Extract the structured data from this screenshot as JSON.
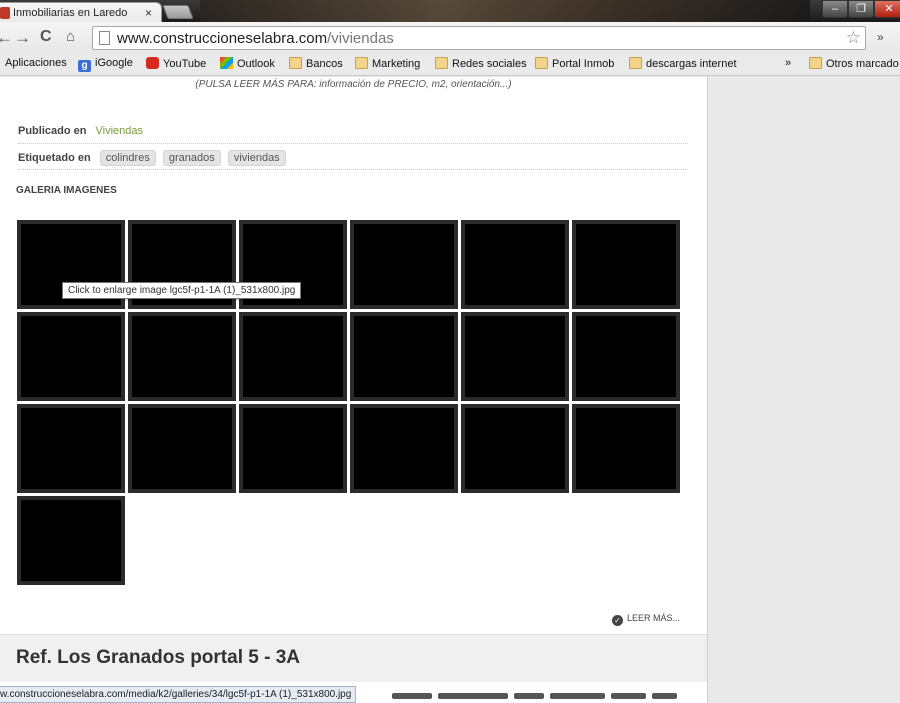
{
  "window": {
    "tab_title": "Inmobiliarias en Laredo",
    "tab_close": "×",
    "controls": {
      "minimize": "–",
      "maximize": "❐",
      "close": "✕"
    }
  },
  "toolbar": {
    "back": "←",
    "forward": "→",
    "reload": "C",
    "home": "⌂",
    "url_host": "www.construccioneselabra.com",
    "url_path": "/viviendas",
    "star": "☆",
    "overflow": "»"
  },
  "bookmarks": {
    "apps": "Aplicaciones",
    "items": [
      "iGoogle",
      "YouTube",
      "Outlook",
      "Bancos",
      "Marketing",
      "Redes sociales",
      "Portal Inmob",
      "descargas internet"
    ],
    "overflow": "»",
    "other": "Otros marcado"
  },
  "article": {
    "pulsa_note": "(PULSA LEER MÁS PARA: información de PRECIO, m2, orientación...)",
    "published_label": "Publicado en",
    "category": "Viviendas",
    "tagged_label": "Etiquetado en",
    "tags": [
      "colindres",
      "granados",
      "viviendas"
    ],
    "gallery_title": "GALERIA IMAGENES",
    "gallery_count": 19,
    "tooltip": "Click to enlarge image lgc5f-p1-1A (1)_531x800.jpg",
    "read_more": "LEER MÁS...",
    "next_title": "Ref. Los Granados portal 5 - 3A"
  },
  "statusbar": {
    "url": "w.construccioneselabra.com/media/k2/galleries/34/lgc5f-p1-1A (1)_531x800.jpg"
  },
  "colors": {
    "category_link": "#7a9a3a",
    "thumb_border": "#2b2b2b",
    "close_button": "#b02010"
  }
}
